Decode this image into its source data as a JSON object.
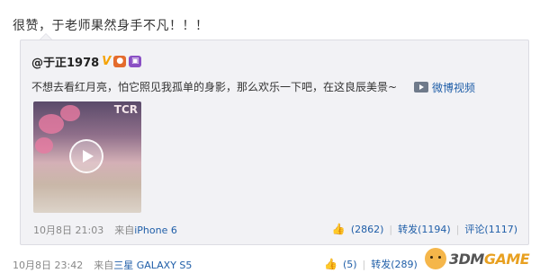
{
  "post": {
    "text": "很赞，于老师果然身手不凡！！！",
    "timestamp": "10月8日 23:42",
    "source_prefix": "来自",
    "source": "三星 GALAXY S5",
    "likes": "(5)",
    "reposts_label": "转发(289)"
  },
  "repost": {
    "author": "@于正1978",
    "verified_badge": "V",
    "text": "不想去看红月亮，怕它照见我孤单的身影，那么欢乐一下吧，在这良辰美景~",
    "video_link_label": "微博视频",
    "thumb_overlay_text": "TCR",
    "timestamp": "10月8日 21:03",
    "source_prefix": "来自",
    "source": "iPhone 6",
    "likes": "(2862)",
    "reposts_label": "转发(1194)",
    "comments_label": "评论(1117)",
    "separator": "|"
  },
  "watermark": {
    "brand_prefix": "3DM",
    "brand_suffix": "GAME"
  }
}
